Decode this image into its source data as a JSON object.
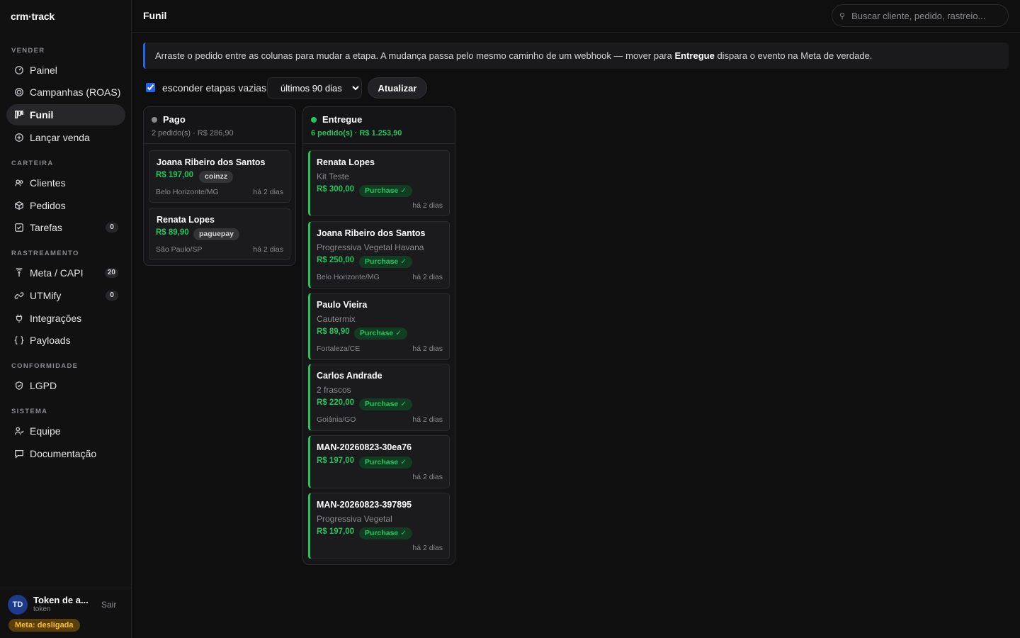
{
  "app": {
    "logo": "crm·track"
  },
  "sidebar": {
    "sections": {
      "vender": "VENDER",
      "carteira": "CARTEIRA",
      "rastreamento": "RASTREAMENTO",
      "conformidade": "CONFORMIDADE",
      "sistema": "SISTEMA"
    },
    "items": [
      {
        "label": "Painel",
        "icon": "gauge-icon"
      },
      {
        "label": "Campanhas (ROAS)",
        "icon": "target-icon"
      },
      {
        "label": "Funil",
        "icon": "kanban-icon",
        "active": true
      },
      {
        "label": "Lançar venda",
        "icon": "plus-circle-icon"
      },
      {
        "label": "Clientes",
        "icon": "users-icon"
      },
      {
        "label": "Pedidos",
        "icon": "box-icon"
      },
      {
        "label": "Tarefas",
        "icon": "checkbox-icon",
        "badge": "0"
      },
      {
        "label": "Meta / CAPI",
        "icon": "broadcast-icon",
        "badge": "20"
      },
      {
        "label": "UTMify",
        "icon": "link-icon",
        "badge": "0"
      },
      {
        "label": "Integrações",
        "icon": "plug-icon"
      },
      {
        "label": "Payloads",
        "icon": "braces-icon"
      },
      {
        "label": "LGPD",
        "icon": "shield-icon"
      },
      {
        "label": "Equipe",
        "icon": "user-group-icon"
      },
      {
        "label": "Documentação",
        "icon": "chat-icon"
      }
    ]
  },
  "user": {
    "initials": "TD",
    "name": "Token de a...",
    "sub": "token",
    "logout": "Sair",
    "meta_status": "Meta: desligada"
  },
  "header": {
    "title": "Funil",
    "search_placeholder": "Buscar cliente, pedido, rastreio..."
  },
  "banner": {
    "text_before": "Arraste o pedido entre as colunas para mudar a etapa. A mudança passa pelo mesmo caminho de um webhook — mover para ",
    "bold": "Entregue",
    "text_after": " dispara o evento na Meta de verdade."
  },
  "controls": {
    "hide_empty_label": "esconder etapas vazias",
    "hide_empty_checked": true,
    "period_selected": "últimos 90 dias",
    "period_options": [
      "últimos 90 dias"
    ],
    "refresh_label": "Atualizar"
  },
  "colors": {
    "accent": "#2563eb",
    "success": "#22c55e",
    "warning": "#fbbf24"
  },
  "columns": [
    {
      "title": "Pago",
      "summary": "2 pedido(s) · R$ 286,90",
      "dot_color": "#8a8a90",
      "cards": [
        {
          "name": "Joana Ribeiro dos Santos",
          "price": "R$ 197,00",
          "tag": "coinzz",
          "location": "Belo Horizonte/MG",
          "time": "há 2 dias"
        },
        {
          "name": "Renata Lopes",
          "price": "R$ 89,90",
          "tag": "paguepay",
          "location": "São Paulo/SP",
          "time": "há 2 dias"
        }
      ]
    },
    {
      "title": "Entregue",
      "summary": "6 pedido(s) · R$ 1.253,90",
      "dot_color": "#22c55e",
      "cards": [
        {
          "name": "Renata Lopes",
          "product": "Kit Teste",
          "price": "R$ 300,00",
          "tag": "Purchase ✓",
          "location": "",
          "time": "há 2 dias"
        },
        {
          "name": "Joana Ribeiro dos Santos",
          "product": "Progressiva Vegetal Havana",
          "price": "R$ 250,00",
          "tag": "Purchase ✓",
          "location": "Belo Horizonte/MG",
          "time": "há 2 dias"
        },
        {
          "name": "Paulo Vieira",
          "product": "Cautermix",
          "price": "R$ 89,90",
          "tag": "Purchase ✓",
          "location": "Fortaleza/CE",
          "time": "há 2 dias"
        },
        {
          "name": "Carlos Andrade",
          "product": "2 frascos",
          "price": "R$ 220,00",
          "tag": "Purchase ✓",
          "location": "Goiânia/GO",
          "time": "há 2 dias"
        },
        {
          "name": "MAN-20260823-30ea76",
          "price": "R$ 197,00",
          "tag": "Purchase ✓",
          "location": "",
          "time": "há 2 dias"
        },
        {
          "name": "MAN-20260823-397895",
          "product": "Progressiva Vegetal",
          "price": "R$ 197,00",
          "tag": "Purchase ✓",
          "location": "",
          "time": "há 2 dias"
        }
      ]
    }
  ]
}
